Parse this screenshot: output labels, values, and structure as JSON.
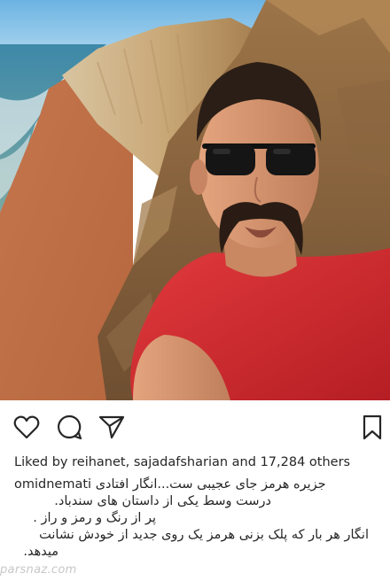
{
  "post": {
    "likes": {
      "prefix": "Liked by",
      "user1": "reihanet",
      "sep": ",",
      "user2": "sajadafsharian",
      "and": "and",
      "count": "17,284",
      "suffix": "others"
    },
    "caption": {
      "username": "omidnemati",
      "line1": "جزیره هرمز جای عجیبی ست...انگار افتادی",
      "line2": "درست وسط یکی از داستان های سندباد.",
      "line3": "پر از رنگ و رمز و راز .",
      "line4": "انگار هر بار که پلک بزنی هرمز یک روی جدید از خودش نشانت",
      "line5": "میدهد."
    }
  },
  "icons": {
    "like": "heart-outline",
    "comment": "speech-bubble",
    "share": "paper-plane",
    "save": "bookmark"
  },
  "watermark": "parsnaz.com",
  "colors": {
    "text": "#262626",
    "shirt": "#d42b2f",
    "sea": "#4c8fa8",
    "cliff": "#c79a5c"
  }
}
